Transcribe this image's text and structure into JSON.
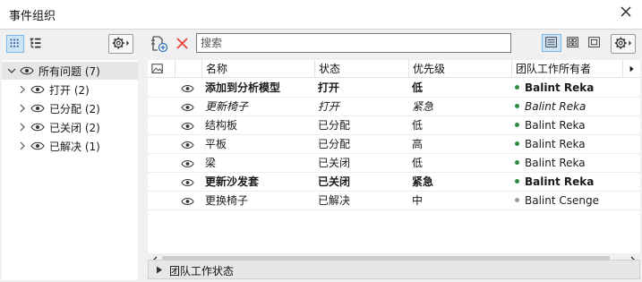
{
  "window": {
    "title": "事件组织"
  },
  "left": {
    "tree": [
      {
        "label": "所有问题 (7)",
        "expanded": true,
        "selected": true,
        "level": 0
      },
      {
        "label": "打开 (2)",
        "expanded": false,
        "level": 1
      },
      {
        "label": "已分配 (2)",
        "expanded": false,
        "level": 1
      },
      {
        "label": "已关闭 (2)",
        "expanded": false,
        "level": 1
      },
      {
        "label": "已解决 (1)",
        "expanded": false,
        "level": 1
      }
    ]
  },
  "toolbar": {
    "search_placeholder": "搜索"
  },
  "table": {
    "columns": [
      "名称",
      "状态",
      "优先级",
      "团队工作所有者"
    ],
    "rows": [
      {
        "name": "添加到分析模型",
        "status": "打开",
        "priority": "低",
        "owner": "Balint Reka",
        "style": "bold",
        "dot": "#2e8b3e"
      },
      {
        "name": "更新椅子",
        "status": "打开",
        "priority": "紧急",
        "owner": "Balint Reka",
        "style": "italic",
        "dot": "#2e8b3e"
      },
      {
        "name": "结构板",
        "status": "已分配",
        "priority": "低",
        "owner": "Balint Reka",
        "style": "normal",
        "dot": "#2e8b3e"
      },
      {
        "name": "平板",
        "status": "已分配",
        "priority": "高",
        "owner": "Balint Reka",
        "style": "normal",
        "dot": "#2e8b3e"
      },
      {
        "name": "梁",
        "status": "已关闭",
        "priority": "低",
        "owner": "Balint Reka",
        "style": "normal",
        "dot": "#2e8b3e"
      },
      {
        "name": "更新沙发套",
        "status": "已关闭",
        "priority": "紧急",
        "owner": "Balint Reka",
        "style": "bold",
        "dot": "#2e8b3e"
      },
      {
        "name": "更换椅子",
        "status": "已解决",
        "priority": "中",
        "owner": "Balint Csenge",
        "style": "normal",
        "dot": "#9a9a9a"
      }
    ]
  },
  "status_panel": {
    "label": "团队工作状态"
  },
  "colors": {
    "accent": "#cfe3f7",
    "accent_border": "#7eb4ea",
    "owner_dot": "#2e8b3e",
    "delete_red": "#e8423a"
  }
}
